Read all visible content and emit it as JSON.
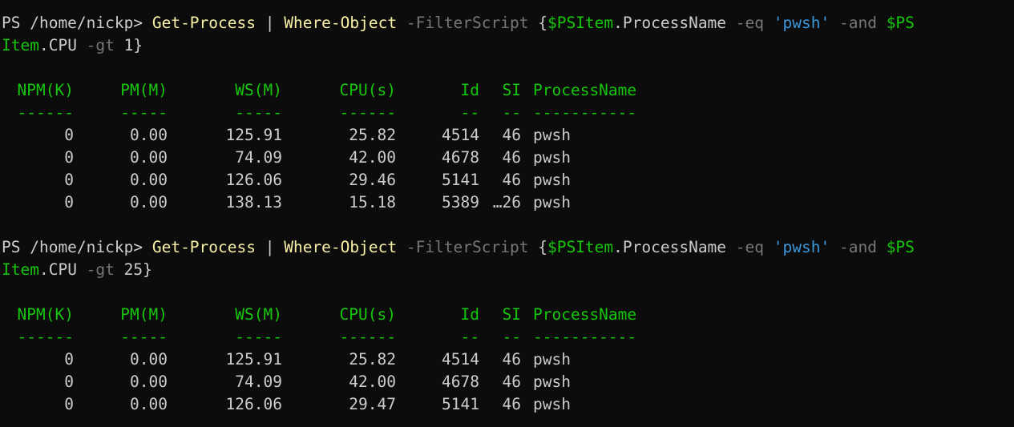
{
  "colors": {
    "background": "#0c0c0c",
    "default_text": "#cccccc",
    "command": "#f9f1a5",
    "parameter": "#767676",
    "variable": "#16c60c",
    "string": "#3a96dd",
    "header": "#16c60c"
  },
  "commands": [
    {
      "prompt": "PS /home/nickp> ",
      "cmdlet": "Get-Process",
      "pipe": " | ",
      "cmdlet2": "Where-Object",
      "sp1": " ",
      "param": "-FilterScript",
      "sp2": " {",
      "var1": "$PSItem",
      "prop1": ".ProcessName ",
      "op1": "-eq",
      "sp3": " ",
      "str": "'pwsh'",
      "sp4": " ",
      "op2": "-and",
      "sp5": " ",
      "var2a": "$PS",
      "var2b": "Item",
      "prop2": ".CPU ",
      "op3": "-gt",
      "value": " 1}",
      "table": {
        "headers": [
          "NPM(K)",
          "PM(M)",
          "WS(M)",
          "CPU(s)",
          "Id",
          "SI",
          "ProcessName"
        ],
        "dashes": [
          "------",
          "-----",
          "-----",
          "------",
          "--",
          "--",
          "-----------"
        ],
        "rows": [
          [
            "0",
            "0.00",
            "125.91",
            "25.82",
            "4514",
            "46",
            "pwsh"
          ],
          [
            "0",
            "0.00",
            "74.09",
            "42.00",
            "4678",
            "46",
            "pwsh"
          ],
          [
            "0",
            "0.00",
            "126.06",
            "29.46",
            "5141",
            "46",
            "pwsh"
          ],
          [
            "0",
            "0.00",
            "138.13",
            "15.18",
            "5389",
            "…26",
            "pwsh"
          ]
        ]
      }
    },
    {
      "prompt": "PS /home/nickp> ",
      "cmdlet": "Get-Process",
      "pipe": " | ",
      "cmdlet2": "Where-Object",
      "sp1": " ",
      "param": "-FilterScript",
      "sp2": " {",
      "var1": "$PSItem",
      "prop1": ".ProcessName ",
      "op1": "-eq",
      "sp3": " ",
      "str": "'pwsh'",
      "sp4": " ",
      "op2": "-and",
      "sp5": " ",
      "var2a": "$PS",
      "var2b": "Item",
      "prop2": ".CPU ",
      "op3": "-gt",
      "value": " 25}",
      "table": {
        "headers": [
          "NPM(K)",
          "PM(M)",
          "WS(M)",
          "CPU(s)",
          "Id",
          "SI",
          "ProcessName"
        ],
        "dashes": [
          "------",
          "-----",
          "-----",
          "------",
          "--",
          "--",
          "-----------"
        ],
        "rows": [
          [
            "0",
            "0.00",
            "125.91",
            "25.82",
            "4514",
            "46",
            "pwsh"
          ],
          [
            "0",
            "0.00",
            "74.09",
            "42.00",
            "4678",
            "46",
            "pwsh"
          ],
          [
            "0",
            "0.00",
            "126.06",
            "29.47",
            "5141",
            "46",
            "pwsh"
          ]
        ]
      }
    }
  ]
}
